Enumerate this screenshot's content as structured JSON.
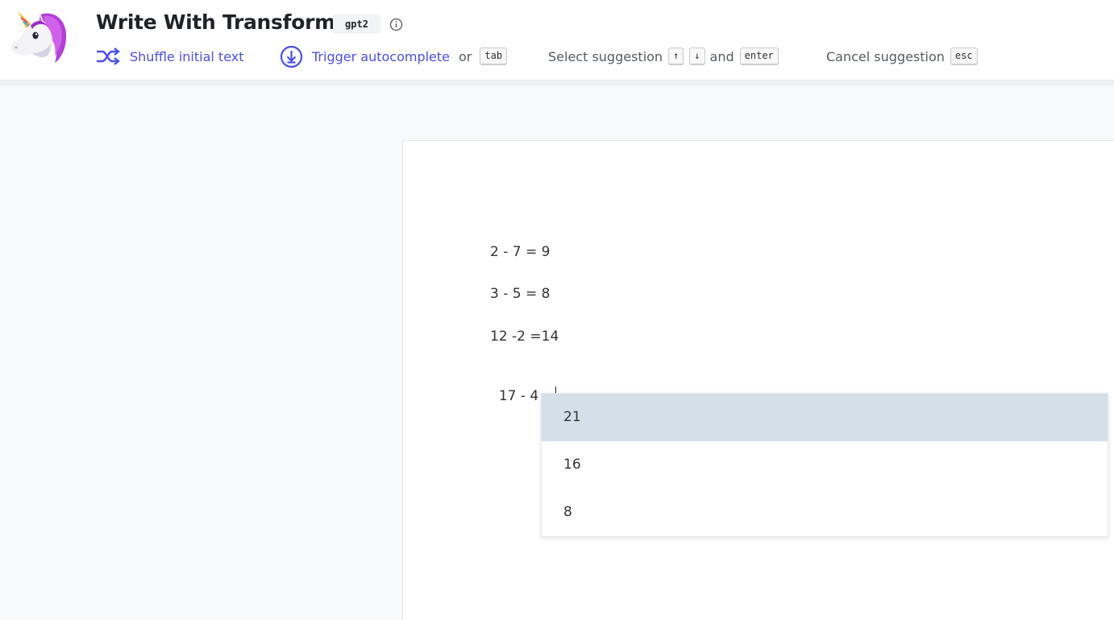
{
  "header": {
    "title": "Write With Transformer",
    "model": "gpt2"
  },
  "toolbar": {
    "shuffle_label": "Shuffle initial text",
    "trigger_label": "Trigger autocomplete",
    "or_text": "or",
    "tab_key": "tab",
    "select_label": "Select suggestion",
    "up_key": "↑",
    "down_key": "↓",
    "and_text": "and",
    "enter_key": "enter",
    "cancel_label": "Cancel suggestion",
    "esc_key": "esc"
  },
  "editor": {
    "lines": [
      "2 - 7 = 9",
      "3 - 5 = 8",
      "12 -2 =14",
      "17 - 4 ="
    ]
  },
  "suggestions": {
    "items": [
      "21",
      "16",
      "8"
    ],
    "selected_index": 0
  },
  "colors": {
    "accent": "#4b50e8",
    "selected_suggestion": "#d3e0e9",
    "page_background": "#f8f9fa"
  },
  "icons": {
    "logo": "unicorn-logo-icon",
    "info": "info-icon",
    "shuffle": "shuffle-icon",
    "trigger": "download-circle-icon"
  }
}
